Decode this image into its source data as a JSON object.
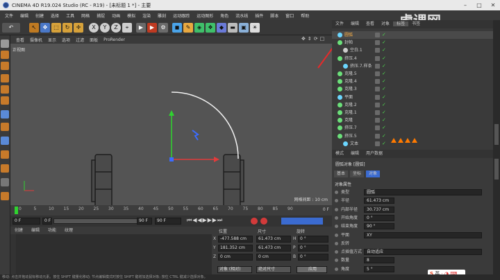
{
  "window": {
    "title": "CINEMA 4D R19.024 Studio (RC - R19) - [未标题 1 *] - 主要"
  },
  "menubar": [
    "文件",
    "编辑",
    "创建",
    "选择",
    "工具",
    "网格",
    "捕捉",
    "动画",
    "模拟",
    "渲染",
    "雕刻",
    "运动跟踪",
    "运动图形",
    "角色",
    "流水线",
    "插件",
    "脚本",
    "窗口",
    "帮助"
  ],
  "watermark": "虎课网",
  "toolbar": {
    "axes": [
      "X",
      "Y",
      "Z"
    ]
  },
  "viewport": {
    "menu": [
      "查看",
      "摄像机",
      "显示",
      "选项",
      "过滤",
      "面板",
      "ProRender"
    ],
    "label": "正视图",
    "grid_spacing": "网格间距 : 10 cm"
  },
  "timeline": {
    "ticks": [
      "0",
      "5",
      "10",
      "15",
      "20",
      "25",
      "30",
      "35",
      "40",
      "45",
      "50",
      "55",
      "60",
      "65",
      "70",
      "75",
      "80",
      "85",
      "90"
    ],
    "end_label": "0 F"
  },
  "playback": {
    "current_frame": "0 F",
    "start_frame": "0 F",
    "end_frame": "90 F",
    "max_frame": "90 F"
  },
  "material_panel": {
    "tabs": [
      "创建",
      "编辑",
      "功能",
      "纹理"
    ]
  },
  "coordinates": {
    "headers": [
      "位置",
      "尺寸",
      "旋转"
    ],
    "rows": [
      {
        "axis": "X",
        "pos": "-477.588 cm",
        "size": "61.473 cm",
        "rot_axis": "H",
        "rot": "0 °"
      },
      {
        "axis": "Y",
        "pos": "181.352 cm",
        "size": "61.473 cm",
        "rot_axis": "P",
        "rot": "0 °"
      },
      {
        "axis": "Z",
        "pos": "0 cm",
        "size": "0 cm",
        "rot_axis": "B",
        "rot": "0 °"
      }
    ],
    "mode_select": "对象 (相对)",
    "size_select": "绝对尺寸",
    "apply_button": "应用"
  },
  "object_manager": {
    "tabs": [
      "文件",
      "编辑",
      "查看",
      "对象",
      "标签",
      "书签"
    ],
    "objects": [
      {
        "name": "圆弧",
        "indent": 0,
        "icon_color": "#6bd6ff",
        "selected": true
      },
      {
        "name": "封帕",
        "indent": 0,
        "icon_color": "#6be07a",
        "selected": false
      },
      {
        "name": "空白.1",
        "indent": 1,
        "icon_color": "#cccccc",
        "selected": false
      },
      {
        "name": "挤压.4",
        "indent": 0,
        "icon_color": "#6be07a",
        "selected": false
      },
      {
        "name": "挤压.7.样条",
        "indent": 1,
        "icon_color": "#6bd6ff",
        "selected": false
      },
      {
        "name": "克隆.5",
        "indent": 0,
        "icon_color": "#6be07a",
        "selected": false
      },
      {
        "name": "克隆.4",
        "indent": 0,
        "icon_color": "#6be07a",
        "selected": false
      },
      {
        "name": "克隆.3",
        "indent": 0,
        "icon_color": "#6be07a",
        "selected": false
      },
      {
        "name": "平面",
        "indent": 0,
        "icon_color": "#6bd6ff",
        "selected": false
      },
      {
        "name": "克隆.2",
        "indent": 0,
        "icon_color": "#6be07a",
        "selected": false
      },
      {
        "name": "克隆.1",
        "indent": 0,
        "icon_color": "#6be07a",
        "selected": false
      },
      {
        "name": "克隆",
        "indent": 0,
        "icon_color": "#6be07a",
        "selected": false
      },
      {
        "name": "挤压.7",
        "indent": 0,
        "icon_color": "#6be07a",
        "selected": false
      },
      {
        "name": "挤压.5",
        "indent": 0,
        "icon_color": "#6be07a",
        "selected": false
      },
      {
        "name": "文本",
        "indent": 1,
        "icon_color": "#6bd6ff",
        "selected": false
      }
    ]
  },
  "attributes": {
    "tabs": [
      "模式",
      "编辑",
      "用户数据"
    ],
    "object_title": "圆弧对象 [圆弧]",
    "subtabs": [
      "基本",
      "坐标",
      "对象"
    ],
    "section": "对象属性",
    "props": [
      {
        "label": "类型",
        "value": "圆弧"
      },
      {
        "label": "半径",
        "value": "61.473 cm"
      },
      {
        "label": "内部半径",
        "value": "30.737 cm"
      },
      {
        "label": "开始角度",
        "value": "0 °"
      },
      {
        "label": "结束角度",
        "value": "90 °"
      },
      {
        "label": "平面",
        "value": "XY"
      },
      {
        "label": "反转",
        "value": ""
      },
      {
        "label": "点插值方式",
        "value": "自动适应"
      },
      {
        "label": "数量",
        "value": "8"
      },
      {
        "label": "角度",
        "value": "5 °"
      }
    ]
  },
  "ime": {
    "label": "英"
  },
  "status": {
    "text": "移动: 点击并拖动鼠标移动元素。按住 SHIFT 键量化移动; 节点编辑模式时按住 SHIFT 键增加选择对象; 按住 CTRL 键减少选择对象。"
  },
  "colors": {
    "accent": "#ff7a00",
    "axis_x": "#e23b3b",
    "axis_y": "#2fd32f",
    "axis_z": "#3c6cff"
  }
}
